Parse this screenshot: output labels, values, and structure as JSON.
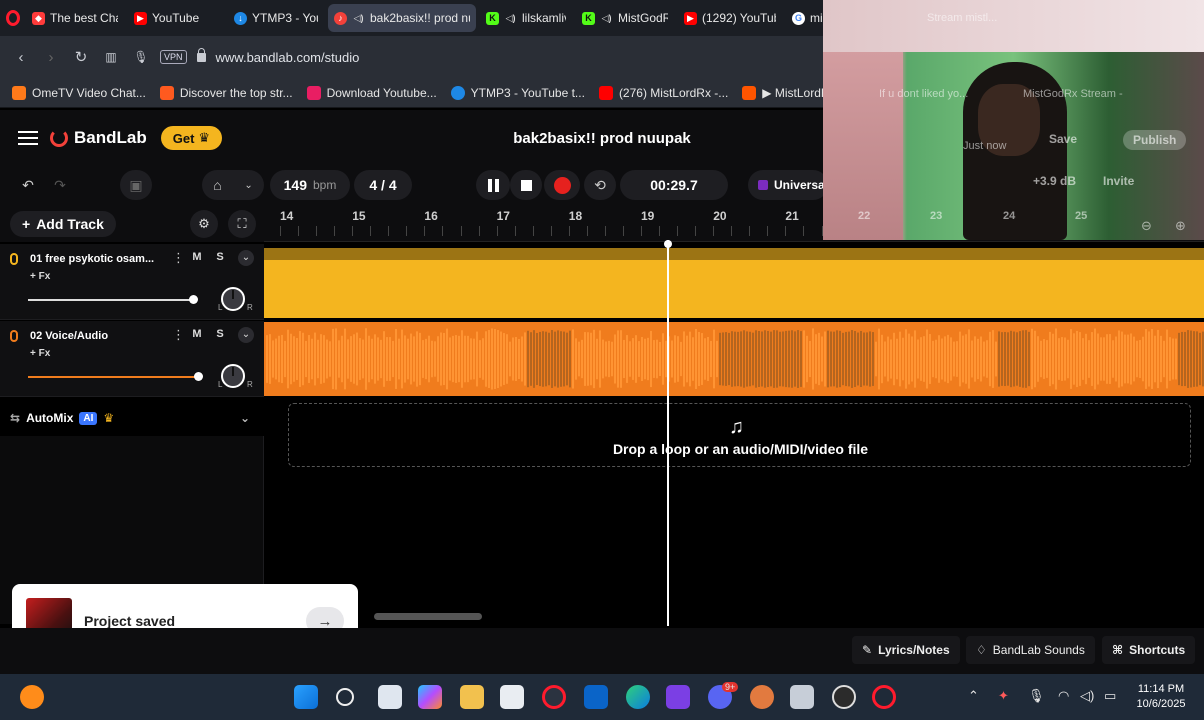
{
  "browser": {
    "tabs": [
      {
        "label": "The best Chat",
        "color": "#ff3b3b",
        "icon": "opera-gx-icon"
      },
      {
        "label": "YouTube",
        "color": "#ff0000",
        "icon": "youtube-icon"
      },
      {
        "label": "YTMP3 - YouTu",
        "color": "#1e88e5",
        "icon": "ytmp3-icon"
      },
      {
        "label": "bak2basix!! prod nu",
        "color": "#f3413a",
        "icon": "bandlab-icon",
        "active": true
      },
      {
        "label": "lilskamlive",
        "color": "#53fc18",
        "icon": "kick-icon"
      },
      {
        "label": "MistGodRx",
        "color": "#53fc18",
        "icon": "kick-icon"
      },
      {
        "label": "(1292) YouTub",
        "color": "#ff0000",
        "icon": "youtube-icon"
      },
      {
        "label": "mistlordrx - Go",
        "color": "#4285f4",
        "icon": "google-icon"
      }
    ],
    "url": "www.bandlab.com/studio",
    "vpn_label": "VPN",
    "bookmarks": [
      {
        "label": "OmeTV Video Chat...",
        "color": "#ff7a1a"
      },
      {
        "label": "Discover the top str...",
        "color": "#ff5a1f"
      },
      {
        "label": "Download Youtube...",
        "color": "#e91e63"
      },
      {
        "label": "YTMP3 - YouTube t...",
        "color": "#1e88e5"
      },
      {
        "label": "(276) MistLordRx -...",
        "color": "#ff0000"
      },
      {
        "label": "▶ MistLordRx idek...",
        "color": "#ff5500"
      }
    ]
  },
  "bandlab": {
    "brand": "BandLab",
    "get_label": "Get",
    "project_title": "bak2basix!! prod nuupak",
    "bpm_value": "149",
    "bpm_unit": "bpm",
    "time_sig": "4 / 4",
    "time_display": "00:29.7",
    "instrument": "Universal",
    "db_value": "+3.9 dB",
    "save_label": "Save",
    "publish_label": "Publish",
    "invite_label": "Invite",
    "saved_status": "Just now",
    "add_track_label": "Add Track",
    "ruler_bars": [
      "14",
      "15",
      "16",
      "17",
      "18",
      "19",
      "20",
      "21",
      "22",
      "23",
      "24",
      "25"
    ],
    "tracks": [
      {
        "name": "01  free psykotic osam...",
        "fx": "+ Fx",
        "mute": "M",
        "solo": "S",
        "color": "#f4b51f"
      },
      {
        "name": "02  Voice/Audio",
        "fx": "+ Fx",
        "mute": "M",
        "solo": "S",
        "color": "#f07c1d"
      }
    ],
    "pan_l": "L",
    "pan_r": "R",
    "automix_label": "AutoMix",
    "ai_badge": "AI",
    "drop_text": "Drop a loop or an audio/MIDI/video file",
    "toast_text": "Project saved",
    "footer": {
      "lyrics": "Lyrics/Notes",
      "sounds": "BandLab Sounds",
      "shortcuts": "Shortcuts"
    }
  },
  "webcam": {
    "overlay_title": "Stream mistl...",
    "overlay_line1": "If u dont liked yo...",
    "overlay_line2": "MistGodRx Stream -"
  },
  "taskbar": {
    "time": "11:14 PM",
    "date": "10/6/2025",
    "badge_count": "9+"
  }
}
